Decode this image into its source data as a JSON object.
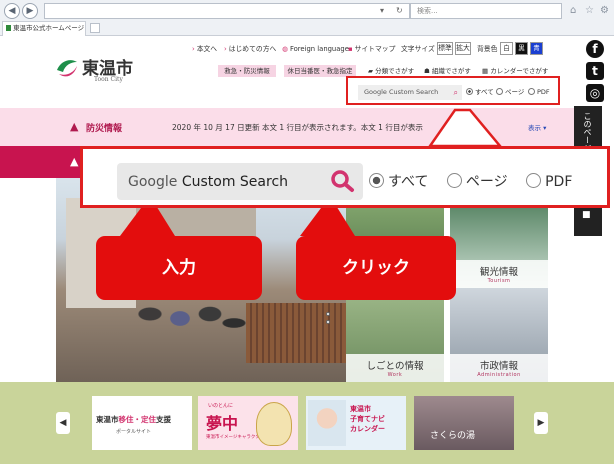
{
  "browser": {
    "address": "",
    "search_placeholder": "検索...",
    "tab_title": "東温市公式ホームページ",
    "refresh_glyph": "↻",
    "dropdown_glyph": "▾"
  },
  "header": {
    "logo_name": "東温市",
    "logo_sub": "Toon City",
    "util_links": [
      "本文へ",
      "はじめての方へ",
      "Foreign language",
      "サイトマップ"
    ],
    "text_size_label": "文字サイズ",
    "text_size_standard": "標準",
    "text_size_large": "拡大",
    "bg_color_label": "背景色",
    "bg_white": "白",
    "bg_black": "黒",
    "bg_blue": "青",
    "pink_buttons": [
      "救急・防災情報",
      "休日当番医・救急指定"
    ],
    "links2": [
      "分類でさがす",
      "組織でさがす",
      "カレンダーでさがす"
    ]
  },
  "search": {
    "placeholder_google": "Google",
    "placeholder_cs": "Custom Search",
    "radio_options": [
      "すべて",
      "ページ",
      "PDF"
    ],
    "selected": "すべて"
  },
  "disaster": {
    "title": "防災情報",
    "date": "2020 年 10 月 17 日更新",
    "body": "本文 1 行目が表示されます。本文 1 行目が表示",
    "show": "表示 ▾"
  },
  "social": {
    "facebook": "f",
    "twitter": "t",
    "instagram": "◎",
    "side_text": "このページ",
    "trash": "🗑"
  },
  "tiles": [
    {
      "label": "観光情報",
      "sub": "Tourism"
    },
    {
      "label": "しごとの情報",
      "sub": "Work"
    },
    {
      "label": "市政情報",
      "sub": "Administration"
    }
  ],
  "banners": {
    "b1_pre": "東温市",
    "b1_hl": "移住・定住",
    "b1_post": "支援",
    "b1_sub": "ポータルサイト",
    "b2_small": "いのとんに",
    "b2_big": "夢中",
    "b2_sub": "東温市イメージキャラクター",
    "b3_line1": "東温市",
    "b3_line2": "子育てナビ",
    "b3_line3": "カレンダー",
    "b4_text": "さくらの湯"
  },
  "callouts": {
    "input": "入力",
    "click": "クリック"
  },
  "colors": {
    "accent": "#d2336e",
    "crimson": "#c8144f",
    "callout_red": "#e30d0d",
    "highlight_border": "#e02020"
  }
}
